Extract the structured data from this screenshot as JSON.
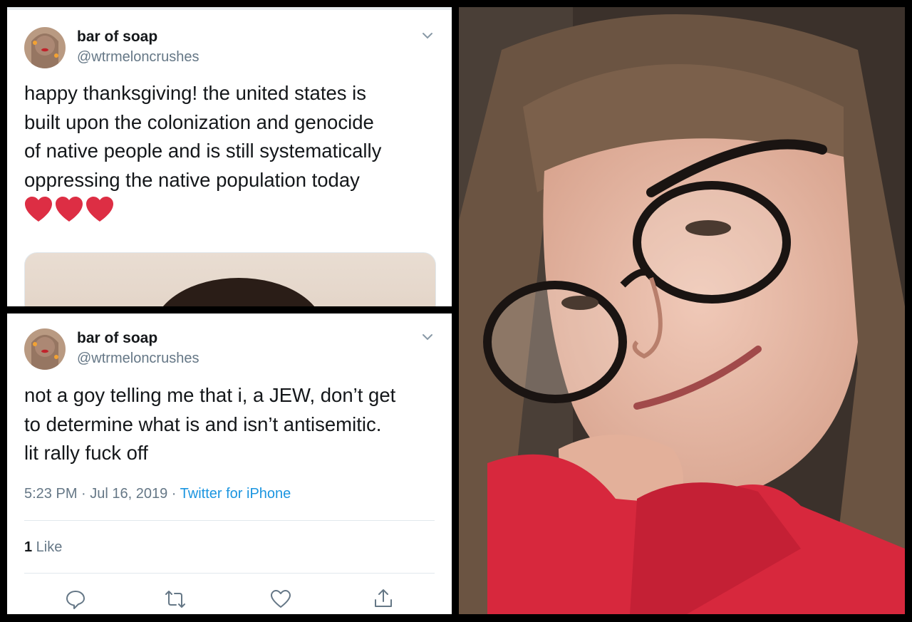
{
  "tweet1": {
    "display_name": "bar of soap",
    "handle": "@wtrmeloncrushes",
    "text": "happy thanksgiving! the united states is\nbuilt upon the colonization and genocide\nof native people and is still systematically\noppressing the native population today",
    "emoji": "❤️❤️❤️",
    "avatar_icon": "profile-photo",
    "menu_icon": "chevron-down-icon"
  },
  "tweet2": {
    "display_name": "bar of soap",
    "handle": "@wtrmeloncrushes",
    "text": "not a goy telling me that i, a JEW, don’t get\nto determine what is and isn’t antisemitic.\nlit rally fuck off",
    "time": "5:23 PM · Jul 16, 2019 · ",
    "source": "Twitter for iPhone",
    "like_count": "1",
    "like_label": " Like",
    "actions": [
      "reply-icon",
      "retweet-icon",
      "like-icon",
      "share-icon"
    ]
  },
  "photo": {
    "subject": "selfie-photo"
  }
}
